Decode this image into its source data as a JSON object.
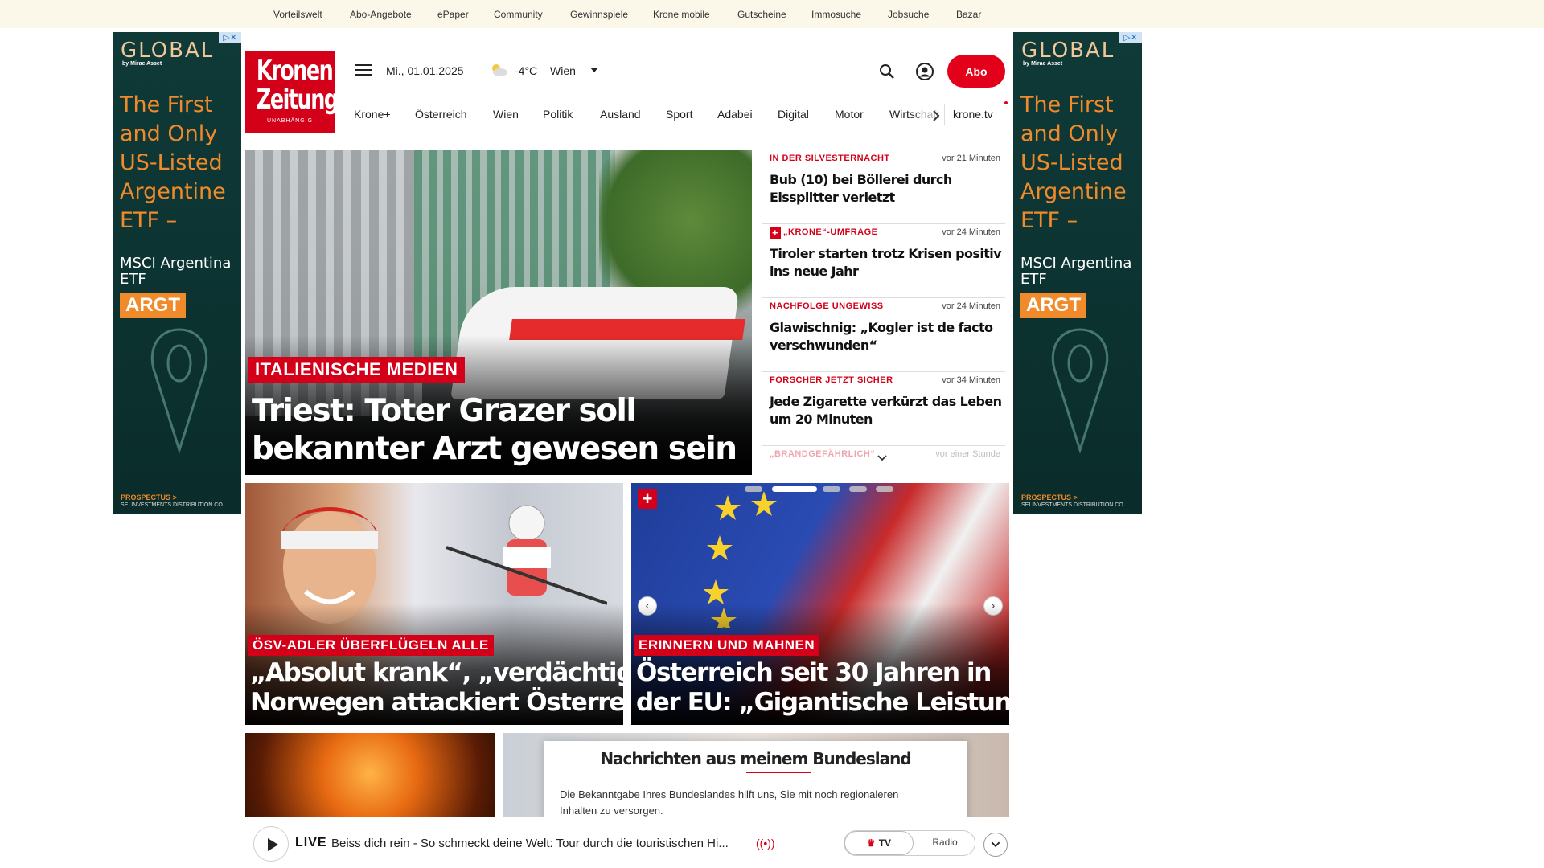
{
  "topbar": {
    "links": [
      "Vorteilswelt",
      "Abo-Angebote",
      "ePaper",
      "Community",
      "Gewinnspiele",
      "Krone mobile",
      "Gutscheine",
      "Immosuche",
      "Jobsuche",
      "Bazar"
    ]
  },
  "ad": {
    "logo": "GLOBAL",
    "logo_sub": "by Mirae Asset",
    "close": "▷✕",
    "headline": "The First and Only US-Listed Argentine ETF –",
    "sub": "MSCI Argentina ETF",
    "badge": "ARGT",
    "footer": "PROSPECTUS >",
    "footer2": "SEI INVESTMENTS DISTRIBUTION CO."
  },
  "brand": {
    "line1": "Kronen",
    "line2": "Zeitung",
    "line3": "UNABHÄNGIG"
  },
  "header": {
    "date": "Mi., 01.01.2025",
    "temperature": "-4°C",
    "city": "Wien",
    "abo_label": "Abo"
  },
  "nav": {
    "items": [
      "Krone+",
      "Österreich",
      "Wien",
      "Politik",
      "Ausland",
      "Sport",
      "Adabei",
      "Digital",
      "Motor",
      "Wirtschaft"
    ],
    "tv": "krone.tv"
  },
  "hero": {
    "kicker": "ITALIENISCHE MEDIEN",
    "title": "Triest: Toter Grazer soll bekannter Arzt gewesen sein"
  },
  "ticker": [
    {
      "kicker": "IN DER SILVESTERNACHT",
      "time": "vor 21 Minuten",
      "title": "Bub (10) bei Böllerei durch Eissplitter verletzt",
      "plus": false
    },
    {
      "kicker": "„KRONE“-UMFRAGE",
      "time": "vor 24 Minuten",
      "title": "Tiroler starten trotz Krisen positiv ins neue Jahr",
      "plus": true
    },
    {
      "kicker": "NACHFOLGE UNGEWISS",
      "time": "vor 24 Minuten",
      "title": "Glawischnig: „Kogler ist de facto verschwunden“",
      "plus": false
    },
    {
      "kicker": "FORSCHER JETZT SICHER",
      "time": "vor 34 Minuten",
      "title": "Jede Zigarette verkürzt das Leben um 20 Minuten",
      "plus": false
    },
    {
      "kicker": "„BRANDGEFÄHRLICH“",
      "time": "vor einer Stunde",
      "title": "",
      "plus": false
    }
  ],
  "cards": [
    {
      "kicker": "ÖSV-ADLER ÜBERFLÜGELN ALLE",
      "title1": "„Absolut krank“, „verdächtig“:",
      "title2": "Norwegen attackiert Österreich"
    },
    {
      "kicker": "ERINNERN UND MAHNEN",
      "title1": "Österreich seit 30 Jahren in",
      "title2": "der EU: „Gigantische Leistung“",
      "plus": "+"
    }
  ],
  "modal": {
    "title": "Nachrichten aus meinem Bundesland",
    "body": "Die Bekanntgabe Ihres Bundeslandes hilft uns, Sie mit noch regionaleren Inhalten zu versorgen."
  },
  "player": {
    "live": "LIVE",
    "text": "Beiss dich rein - So schmeckt deine Welt: Tour durch die touristischen Hi...",
    "radio_icon": "((•))",
    "tv": "TV",
    "radio": "Radio"
  },
  "colors": {
    "accent": "#d4001a",
    "topbar_bg": "#fbf7e9",
    "ad_bg": "#0f3a38",
    "ad_accent": "#f08a2a"
  }
}
